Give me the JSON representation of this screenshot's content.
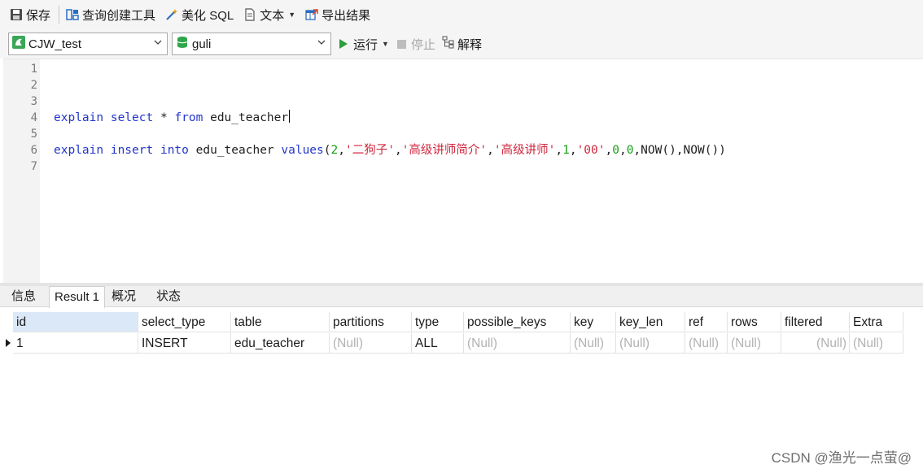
{
  "toolbar": {
    "save_label": "保存",
    "query_builder_label": "查询创建工具",
    "beautify_label": "美化 SQL",
    "text_label": "文本",
    "export_label": "导出结果"
  },
  "selectors": {
    "connection": "CJW_test",
    "database": "guli",
    "run_label": "运行",
    "stop_label": "停止",
    "explain_label": "解释"
  },
  "editor": {
    "line_numbers": [
      "1",
      "2",
      "3",
      "4",
      "5",
      "6",
      "7"
    ],
    "line4": {
      "kw1": "explain",
      "kw2": "select",
      "star": " * ",
      "kw3": "from",
      "table": " edu_teacher"
    },
    "line6": {
      "kw1": "explain",
      "kw2": "insert",
      "kw3": "into",
      "table": " edu_teacher ",
      "kw4": "values",
      "p_open": "(",
      "n1": "2",
      "comma": ",",
      "s1": "'二狗子'",
      "s2": "'高级讲师简介'",
      "s3": "'高级讲师'",
      "n2": "1",
      "s4": "'00'",
      "n3": "0",
      "n4": "0",
      "tail": "NOW(),NOW())"
    }
  },
  "tabs": [
    "信息",
    "Result 1",
    "概况",
    "状态"
  ],
  "result": {
    "columns": [
      "id",
      "select_type",
      "table",
      "partitions",
      "type",
      "possible_keys",
      "key",
      "key_len",
      "ref",
      "rows",
      "filtered",
      "Extra"
    ],
    "row": [
      "1",
      "INSERT",
      "edu_teacher",
      "(Null)",
      "ALL",
      "(Null)",
      "(Null)",
      "(Null)",
      "(Null)",
      "(Null)",
      "(Null)",
      "(Null)"
    ]
  },
  "watermark": "CSDN @渔光一点萤@",
  "colors": {
    "keyword": "#2336c9",
    "string": "#d0273d",
    "number": "#16a016",
    "run": "#2e9e3a",
    "header_selected": "#dbe8f8"
  }
}
